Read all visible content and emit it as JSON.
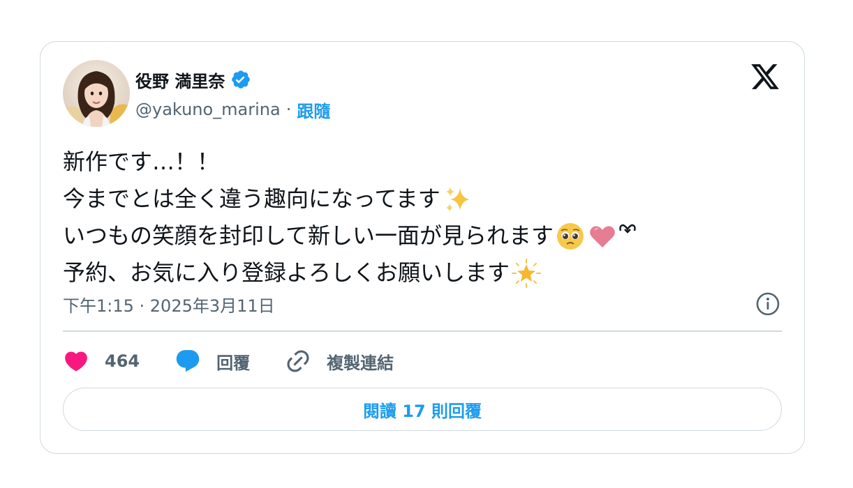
{
  "author": {
    "display_name": "役野 満里奈",
    "handle": "@yakuno_marina",
    "separator": "·",
    "follow_label": "跟隨",
    "verified": true
  },
  "tweet": {
    "lines": [
      {
        "text": "新作です…！！",
        "emoji": ""
      },
      {
        "text": "今までとは全く違う趣向になってます",
        "emoji": "sparkles"
      },
      {
        "text": "いつもの笑顔を封印して新しい一面が見られます",
        "emoji": "pleading-face, pink-heart, ribbon"
      },
      {
        "text": "予約、お気に入り登録よろしくお願いします",
        "emoji": "glowing-star"
      }
    ]
  },
  "timestamp": "下午1:15 · 2025年3月11日",
  "actions": {
    "like_count": "464",
    "reply_label": "回覆",
    "copy_link_label": "複製連結"
  },
  "read_replies_label": "閱讀 17 則回覆",
  "colors": {
    "accent": "#1d9bf0",
    "like": "#f91880",
    "text": "#0f1419",
    "muted": "#536471",
    "border": "#cfd9de"
  },
  "icons": [
    "x-logo-icon",
    "verified-badge-icon",
    "info-icon",
    "heart-icon",
    "reply-bubble-icon",
    "link-icon"
  ]
}
